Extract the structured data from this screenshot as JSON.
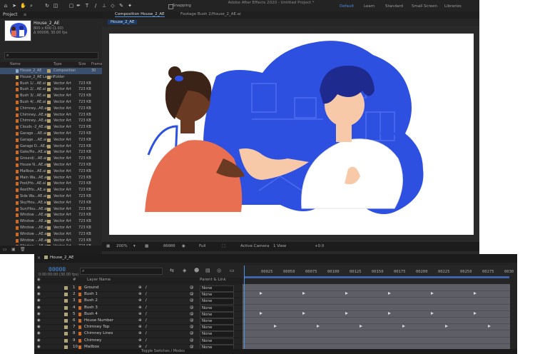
{
  "app": {
    "title": "Adobe After Effects 2020 - Untitled Project *"
  },
  "toolbar": {
    "snapping_label": "Snapping",
    "workspaces": [
      "Default",
      "Learn",
      "Standard",
      "Small Screen",
      "Libraries"
    ],
    "active_workspace_color": "#4a8fe0"
  },
  "project": {
    "panel_label": "Project",
    "selected_item": "House_2_AE",
    "item_info": [
      "800 x 600 (1.00)",
      "Δ 00008, 30.00 fps"
    ],
    "search_placeholder": "",
    "columns": [
      "Name",
      "Type",
      "Size",
      "Frame"
    ],
    "items": [
      {
        "name": "House_2_AE",
        "type": "Composition",
        "size": "",
        "frame": "30"
      },
      {
        "name": "House_2_AE Layers",
        "type": "Folder",
        "size": "",
        "frame": ""
      },
      {
        "name": "Bush 1/...AE.ai",
        "type": "Vector Art",
        "size": "723 KB",
        "frame": ""
      },
      {
        "name": "Bush 2/...AE.ai",
        "type": "Vector Art",
        "size": "723 KB",
        "frame": ""
      },
      {
        "name": "Bush 3/...AE.ai",
        "type": "Vector Art",
        "size": "723 KB",
        "frame": ""
      },
      {
        "name": "Bush 4/...AE.ai",
        "type": "Vector Art",
        "size": "723 KB",
        "frame": ""
      },
      {
        "name": "Chimney...AE.ai",
        "type": "Vector Art",
        "size": "723 KB",
        "frame": ""
      },
      {
        "name": "Chimney...AE.ai",
        "type": "Vector Art",
        "size": "723 KB",
        "frame": ""
      },
      {
        "name": "Chimney...AE.ai",
        "type": "Vector Art",
        "size": "723 KB",
        "frame": ""
      },
      {
        "name": "Clouds -2_AE.ai",
        "type": "Vector Art",
        "size": "723 KB",
        "frame": ""
      },
      {
        "name": "Garage ...AE.ai",
        "type": "Vector Art",
        "size": "723 KB",
        "frame": ""
      },
      {
        "name": "Garage ...AE.ai",
        "type": "Vector Art",
        "size": "723 KB",
        "frame": ""
      },
      {
        "name": "Garage D...AE.ai",
        "type": "Vector Art",
        "size": "723 KB",
        "frame": ""
      },
      {
        "name": "Gate/Ho...AE.ai",
        "type": "Vector Art",
        "size": "723 KB",
        "frame": ""
      },
      {
        "name": "Ground/...AE.ai",
        "type": "Vector Art",
        "size": "723 KB",
        "frame": ""
      },
      {
        "name": "House N...AE.ai",
        "type": "Vector Art",
        "size": "723 KB",
        "frame": ""
      },
      {
        "name": "Mailbox...AE.ai",
        "type": "Vector Art",
        "size": "723 KB",
        "frame": ""
      },
      {
        "name": "Main Wa...AE.ai",
        "type": "Vector Art",
        "size": "723 KB",
        "frame": ""
      },
      {
        "name": "Pool/Ho...AE.ai",
        "type": "Vector Art",
        "size": "723 KB",
        "frame": ""
      },
      {
        "name": "Roof/Ho...AE.ai",
        "type": "Vector Art",
        "size": "723 KB",
        "frame": ""
      },
      {
        "name": "Side Wa...AE.ai",
        "type": "Vector Art",
        "size": "723 KB",
        "frame": ""
      },
      {
        "name": "Sky/Hou...AE.ai",
        "type": "Vector Art",
        "size": "723 KB",
        "frame": ""
      },
      {
        "name": "Sun/Hou...AE.ai",
        "type": "Vector Art",
        "size": "723 KB",
        "frame": ""
      },
      {
        "name": "Window ...AE.ai",
        "type": "Vector Art",
        "size": "723 KB",
        "frame": ""
      },
      {
        "name": "Window ...AE.ai",
        "type": "Vector Art",
        "size": "723 KB",
        "frame": ""
      },
      {
        "name": "Window ...AE.ai",
        "type": "Vector Art",
        "size": "723 KB",
        "frame": ""
      },
      {
        "name": "Window ...AE.ai",
        "type": "Vector Art",
        "size": "723 KB",
        "frame": ""
      },
      {
        "name": "Window ...AE.ai",
        "type": "Vector Art",
        "size": "723 KB",
        "frame": ""
      },
      {
        "name": "Window ...AE.ai",
        "type": "Vector Art",
        "size": "723 KB",
        "frame": ""
      }
    ]
  },
  "composition": {
    "tab_label": "Composition House_2_AE",
    "footage_tab": "Footage Bush 2/House_2_AE.ai",
    "sub_tab": "House_2_AE",
    "zoom": "200%",
    "timecode": "00000",
    "resolution": "Full",
    "camera": "Active Camera",
    "views": "1 View",
    "exposure": "+0.0"
  },
  "timeline": {
    "tab_label": "House_2_AE",
    "current_time": "00000",
    "time_sub": "0:00:00:00 (30.00 fps)",
    "column_headers": [
      "#",
      "Layer Name",
      "Parent & Link"
    ],
    "footer": "Toggle Switches / Modes",
    "ticks": [
      "00025",
      "00050",
      "00075",
      "00100",
      "00125",
      "00150",
      "00175",
      "00200",
      "00225",
      "00250",
      "00275",
      "0030"
    ],
    "layers": [
      {
        "num": "1",
        "name": "Ground",
        "parent": "None"
      },
      {
        "num": "2",
        "name": "Bush 1",
        "parent": "None"
      },
      {
        "num": "3",
        "name": "Bush 2",
        "parent": "None"
      },
      {
        "num": "4",
        "name": "Bush 3",
        "parent": "None"
      },
      {
        "num": "5",
        "name": "Bush 4",
        "parent": "None"
      },
      {
        "num": "6",
        "name": "House Number",
        "parent": "None"
      },
      {
        "num": "7",
        "name": "Chimney Top",
        "parent": "None"
      },
      {
        "num": "8",
        "name": "Chimney Lines",
        "parent": "None"
      },
      {
        "num": "9",
        "name": "Chimney",
        "parent": "None"
      },
      {
        "num": "10",
        "name": "Mailbox",
        "parent": "None"
      }
    ]
  }
}
